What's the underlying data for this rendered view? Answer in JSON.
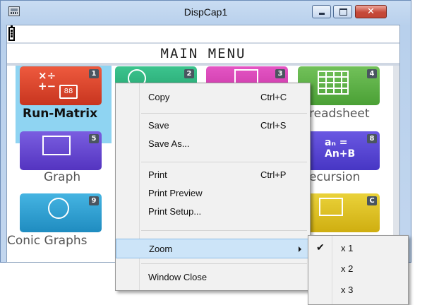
{
  "window": {
    "title": "DispCap1",
    "close_glyph": "✕",
    "icons": [
      "app-icon",
      "minimize-icon",
      "maximize-icon",
      "close-icon"
    ]
  },
  "screen": {
    "heading": "MAIN MENU",
    "selected_label": "Run-Matrix",
    "tiles": [
      {
        "num": "1",
        "label": "Run-Matrix",
        "icon_text": "×÷\n+−[88]",
        "color": "#d8422c"
      },
      {
        "num": "2",
        "label": "",
        "color": "#2fb07c"
      },
      {
        "num": "3",
        "label": "",
        "color": "#d639b0"
      },
      {
        "num": "4",
        "label": "readsheet",
        "color": "#5bb045"
      },
      {
        "num": "5",
        "label": "Graph",
        "color": "#6a4fd0"
      },
      {
        "num": "8",
        "label": "ecursion",
        "icon_text": "aₙ= An+B",
        "color": "#5a48d4"
      },
      {
        "num": "9",
        "label": "Conic Graphs",
        "color": "#2b9ed0"
      },
      {
        "num": "C",
        "label": "",
        "color": "#e0c21a"
      }
    ]
  },
  "context_menu": {
    "items": [
      {
        "label": "Copy",
        "shortcut": "Ctrl+C"
      },
      {
        "label": "Save",
        "shortcut": "Ctrl+S"
      },
      {
        "label": "Save As...",
        "shortcut": ""
      },
      {
        "label": "Print",
        "shortcut": "Ctrl+P"
      },
      {
        "label": "Print Preview",
        "shortcut": ""
      },
      {
        "label": "Print Setup...",
        "shortcut": ""
      },
      {
        "label": "Zoom",
        "shortcut": ""
      },
      {
        "label": "Window Close",
        "shortcut": ""
      }
    ],
    "highlighted": "Zoom"
  },
  "zoom_submenu": {
    "items": [
      "x 1",
      "x 2",
      "x 3"
    ],
    "checked": "x 1",
    "check_glyph": "✔"
  }
}
